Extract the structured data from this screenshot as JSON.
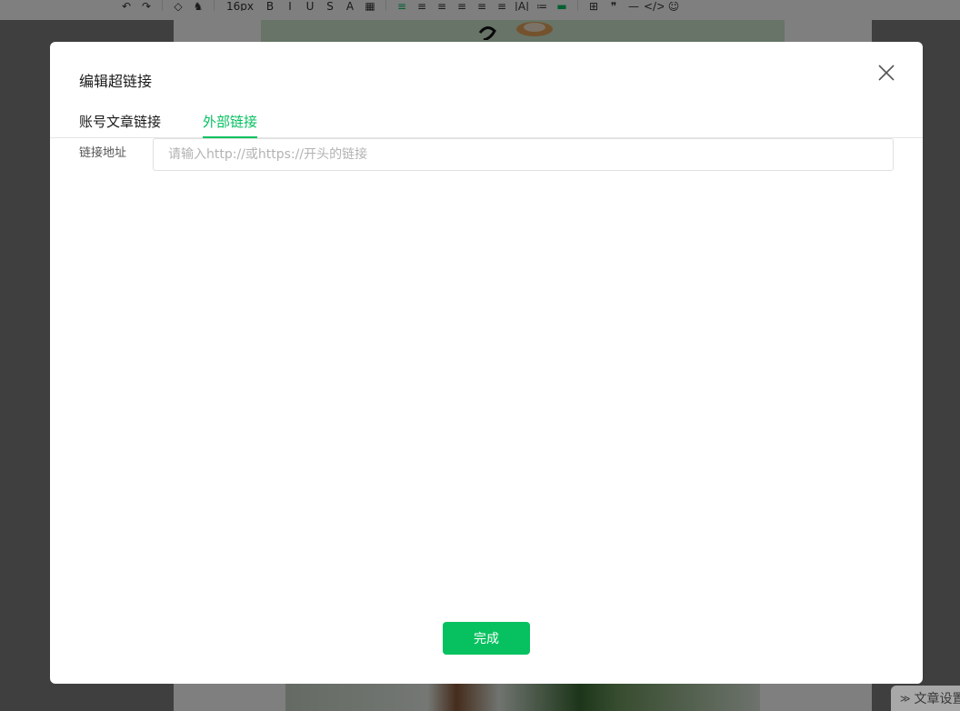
{
  "background": {
    "toolbar": {
      "font_size": "16px",
      "items": [
        "↶",
        "↷",
        "◇",
        "♞",
        "B",
        "I",
        "U",
        "S",
        "A",
        "▦",
        "≡",
        "≡",
        "≡",
        "≡",
        "≡",
        "≡",
        "|A|",
        "≔",
        "▬",
        "⊞",
        "❞",
        "—",
        "</>",
        "☺"
      ]
    },
    "corner_tab": {
      "label": "文章设置"
    }
  },
  "dialog": {
    "title": "编辑超链接",
    "tabs": [
      {
        "label": "账号文章链接",
        "active": false
      },
      {
        "label": "外部链接",
        "active": true
      }
    ],
    "url_field": {
      "label": "链接地址",
      "placeholder": "请输入http://或https://开头的链接",
      "value": ""
    },
    "confirm_label": "完成"
  },
  "colors": {
    "accent": "#07c160",
    "overlay": "rgba(0,0,0,0.5)",
    "dialog_bg": "#ffffff"
  }
}
